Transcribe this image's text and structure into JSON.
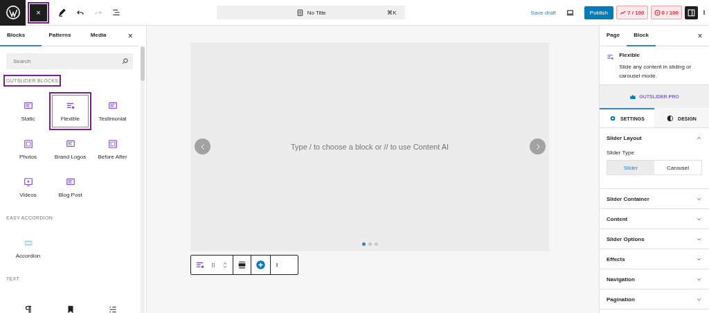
{
  "top_bar": {
    "close_button": {
      "label": "×",
      "highlighted": true
    },
    "document": {
      "title": "No Title",
      "shortcut": "⌘K"
    },
    "save_draft": "Save draft",
    "publish": "Publish",
    "scores": [
      {
        "text": "7 / 100"
      },
      {
        "text": "0 / 100"
      }
    ]
  },
  "inserter": {
    "tabs": [
      {
        "label": "Blocks",
        "selected": true
      },
      {
        "label": "Patterns",
        "selected": false
      },
      {
        "label": "Media",
        "selected": false
      }
    ],
    "close": "×",
    "search": {
      "placeholder": "Search"
    },
    "categories": [
      {
        "title": "GUTSLIDER BLOCKS",
        "highlighted": true,
        "blocks": [
          {
            "label": "Static",
            "selected": false,
            "highlighted": false
          },
          {
            "label": "Flexible",
            "selected": true,
            "highlighted": true
          },
          {
            "label": "Testimonial",
            "selected": false,
            "highlighted": false
          },
          {
            "label": "Photos",
            "selected": false,
            "highlighted": false
          },
          {
            "label": "Brand Logos",
            "selected": false,
            "highlighted": false
          },
          {
            "label": "Before After",
            "selected": false,
            "highlighted": false
          },
          {
            "label": "Videos",
            "selected": false,
            "highlighted": false
          },
          {
            "label": "Blog Post",
            "selected": false,
            "highlighted": false
          }
        ]
      },
      {
        "title": "EASY ACCORDION",
        "highlighted": false,
        "blocks": [
          {
            "label": "Accordion",
            "selected": false,
            "highlighted": false
          }
        ]
      },
      {
        "title": "TEXT",
        "highlighted": false,
        "blocks": [
          {
            "selected": false,
            "highlighted": false
          },
          {
            "selected": false,
            "highlighted": false
          },
          {
            "selected": false,
            "highlighted": false
          }
        ]
      }
    ]
  },
  "canvas": {
    "placeholder": "Type / to choose a block or // to use Content AI",
    "dots": [
      {
        "selected": true
      },
      {
        "selected": false
      },
      {
        "selected": false
      }
    ]
  },
  "sidebar": {
    "tabs": [
      {
        "label": "Page",
        "selected": false
      },
      {
        "label": "Block",
        "selected": true
      }
    ],
    "close": "×",
    "block": {
      "title": "Flexible",
      "description": "Slide any content in sliding or carousel mode."
    },
    "pro_banner": "GUTSLIDER PRO",
    "setting_tabs": [
      {
        "label": "SETTINGS",
        "selected": true
      },
      {
        "label": "DESIGN",
        "selected": false
      }
    ],
    "panels": [
      {
        "title": "Slider Layout",
        "expanded": true,
        "field_label": "Slider Type",
        "options": [
          {
            "label": "Slider",
            "selected": true
          },
          {
            "label": "Carousel",
            "selected": false
          }
        ]
      },
      {
        "title": "Slider Container",
        "expanded": false
      },
      {
        "title": "Content",
        "expanded": false
      },
      {
        "title": "Slider Options",
        "expanded": false
      },
      {
        "title": "Effects",
        "expanded": false
      },
      {
        "title": "Navigation",
        "expanded": false
      },
      {
        "title": "Pagination",
        "expanded": false
      }
    ]
  }
}
